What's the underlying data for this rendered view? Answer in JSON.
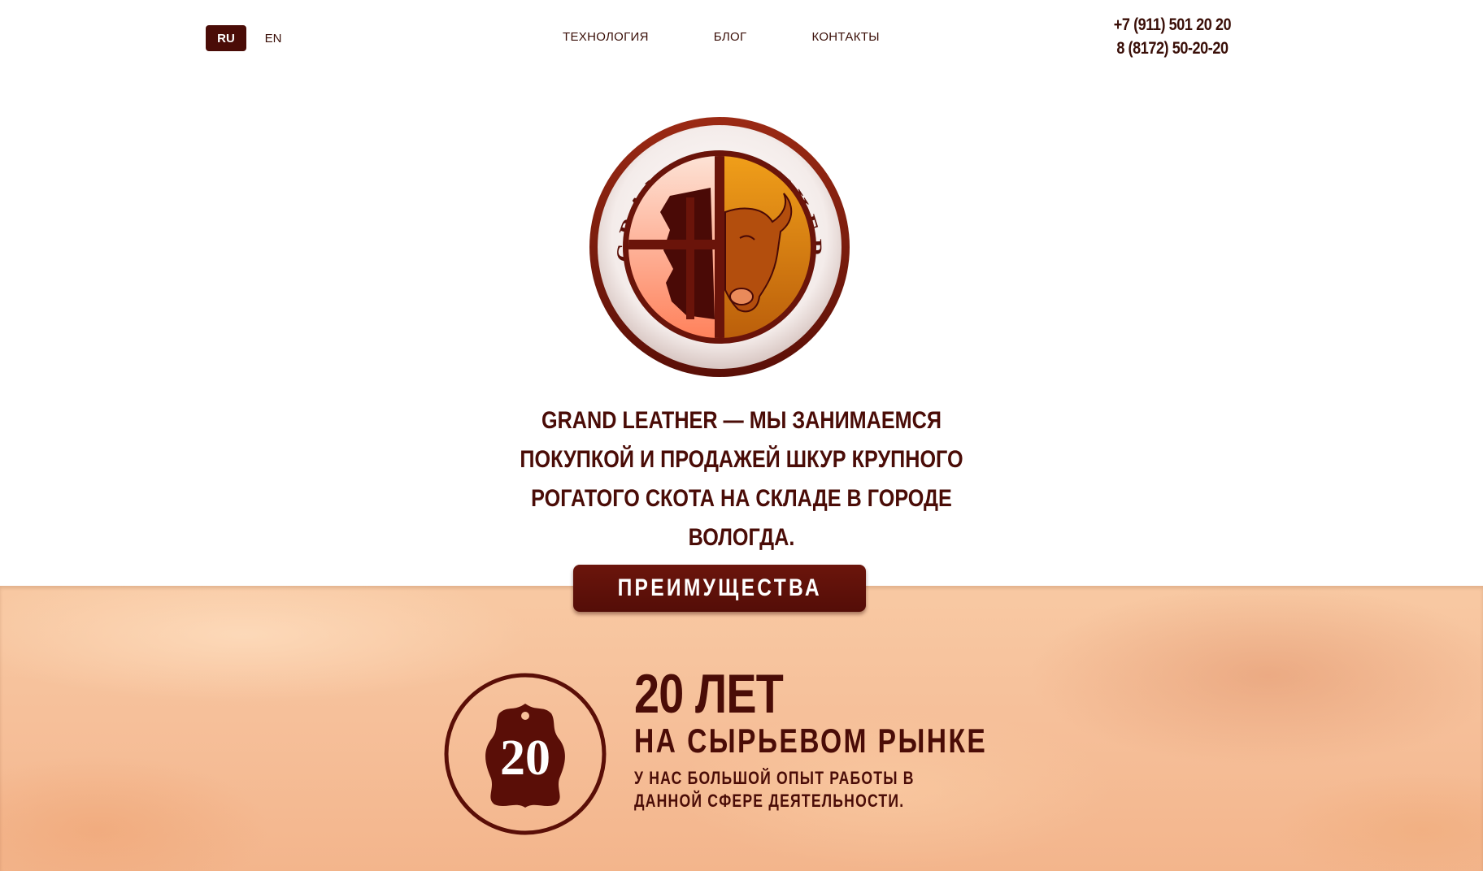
{
  "header": {
    "languages": [
      {
        "label": "RU",
        "active": true
      },
      {
        "label": "EN",
        "active": false
      }
    ],
    "nav": [
      {
        "label": "ТЕХНОЛОГИЯ"
      },
      {
        "label": "БЛОГ"
      },
      {
        "label": "КОНТАКТЫ"
      }
    ],
    "phones": [
      "+7 (911) 501 20 20",
      "8 (8172) 50-20-20"
    ]
  },
  "logo": {
    "ring_text": "GRAND LEATHER",
    "icon": "bull-and-hide-emblem"
  },
  "tagline": "GRAND LEATHER — МЫ ЗАНИМАЕМСЯ ПОКУПКОЙ И ПРОДАЖЕЙ ШКУР КРУПНОГО РОГАТОГО СКОТА НА СКЛАДЕ В ГОРОДЕ ВОЛОГДА.",
  "advantages": {
    "tab_label": "ПРЕИМУЩЕСТВА",
    "items": [
      {
        "icon": "hide-badge-icon",
        "badge_number": "20",
        "title": "20 ЛЕТ",
        "subtitle": "НА СЫРЬЕВОМ РЫНКЕ",
        "description": "У НАС БОЛЬШОЙ ОПЫТ РАБОТЫ В ДАННОЙ СФЕРЕ ДЕЯТЕЛЬНОСТИ."
      }
    ]
  },
  "colors": {
    "brand_dark": "#4a0c07",
    "brand_orange": "#e0890f",
    "band_peach": "#f6c09a"
  }
}
